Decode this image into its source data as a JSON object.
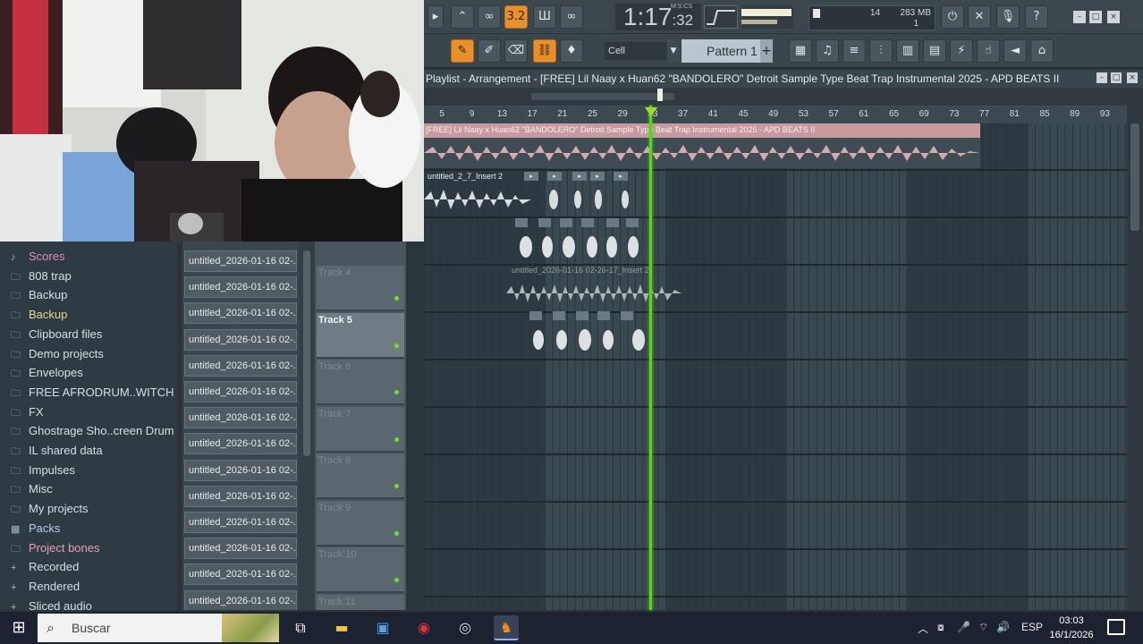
{
  "toolbar": {
    "time_main": "1:17",
    "time_sub": ":32",
    "time_unit": "M:S:CS",
    "pattern_name": "Pattern 1",
    "snap_value": "Cell",
    "cpu_value": "14",
    "memory_value": "283 MB",
    "polyphony_value": "1",
    "tempo_mode": "3.2"
  },
  "playlist": {
    "title": "Playlist - Arrangement - [FREE] Lil Naay x Huan62 \"BANDOLERO\" Detroit Sample Type Beat  Trap Instrumental 2025 - APD BEATS II",
    "ruler_marks": [
      "5",
      "9",
      "13",
      "17",
      "21",
      "25",
      "29",
      "33",
      "37",
      "41",
      "45",
      "49",
      "53",
      "57",
      "61",
      "65",
      "69",
      "73",
      "77",
      "81",
      "85",
      "89",
      "93"
    ],
    "clip_main": "[FREE] Lil Naay x Huan62 \"BANDOLERO\" Detroit Sample Type Beat  Trap Instrumental 2025 - APD BEATS II",
    "clip_insert": "untitled_2_7_Insert 2",
    "clip_insert_long": "untitled_2026-01-16 02-26-17_Insert 2"
  },
  "tracks": [
    {
      "name": "Track 4",
      "active": false
    },
    {
      "name": "Track 5",
      "active": true
    },
    {
      "name": "Track 6",
      "active": false
    },
    {
      "name": "Track 7",
      "active": false
    },
    {
      "name": "Track 8",
      "active": false
    },
    {
      "name": "Track 9",
      "active": false
    },
    {
      "name": "Track 10",
      "active": false
    },
    {
      "name": "Track 11",
      "active": false
    }
  ],
  "browser": {
    "items": [
      {
        "label": "Scores",
        "icon": "♪",
        "style": "mag"
      },
      {
        "label": "808 trap",
        "icon": "🗀",
        "style": ""
      },
      {
        "label": "Backup",
        "icon": "🗀",
        "style": ""
      },
      {
        "label": "Backup",
        "icon": "🗀",
        "style": "highlight"
      },
      {
        "label": "Clipboard files",
        "icon": "🗀",
        "style": ""
      },
      {
        "label": "Demo projects",
        "icon": "🗀",
        "style": ""
      },
      {
        "label": "Envelopes",
        "icon": "🗀",
        "style": ""
      },
      {
        "label": "FREE AFRODRUM..WITCH VIBEZ",
        "icon": "🗀",
        "style": ""
      },
      {
        "label": "FX",
        "icon": "🗀",
        "style": ""
      },
      {
        "label": "Ghostrage Sho..creen Drum Kit",
        "icon": "🗀",
        "style": ""
      },
      {
        "label": "IL shared data",
        "icon": "🗀",
        "style": ""
      },
      {
        "label": "Impulses",
        "icon": "🗀",
        "style": ""
      },
      {
        "label": "Misc",
        "icon": "🗀",
        "style": ""
      },
      {
        "label": "My projects",
        "icon": "🗀",
        "style": ""
      },
      {
        "label": "Packs",
        "icon": "▦",
        "style": "blue"
      },
      {
        "label": "Project bones",
        "icon": "🗀",
        "style": "pink"
      },
      {
        "label": "Recorded",
        "icon": "+",
        "style": ""
      },
      {
        "label": "Rendered",
        "icon": "+",
        "style": ""
      },
      {
        "label": "Sliced audio",
        "icon": "+",
        "style": ""
      }
    ]
  },
  "files": {
    "items": [
      "untitled_2026-01-16 02-...",
      "untitled_2026-01-16 02-...",
      "untitled_2026-01-16 02-...",
      "untitled_2026-01-16 02-...",
      "untitled_2026-01-16 02-...",
      "untitled_2026-01-16 02-...",
      "untitled_2026-01-16 02-...",
      "untitled_2026-01-16 02-...",
      "untitled_2026-01-16 02-...",
      "untitled_2026-01-16 02-...",
      "untitled_2026-01-16 02-...",
      "untitled_2026-01-16 02-...",
      "untitled_2026-01-16 02-...",
      "untitled_2026-01-16 02-..."
    ]
  },
  "taskbar": {
    "search_placeholder": "Buscar",
    "language": "ESP",
    "time": "03:03",
    "date": "16/1/2026"
  }
}
